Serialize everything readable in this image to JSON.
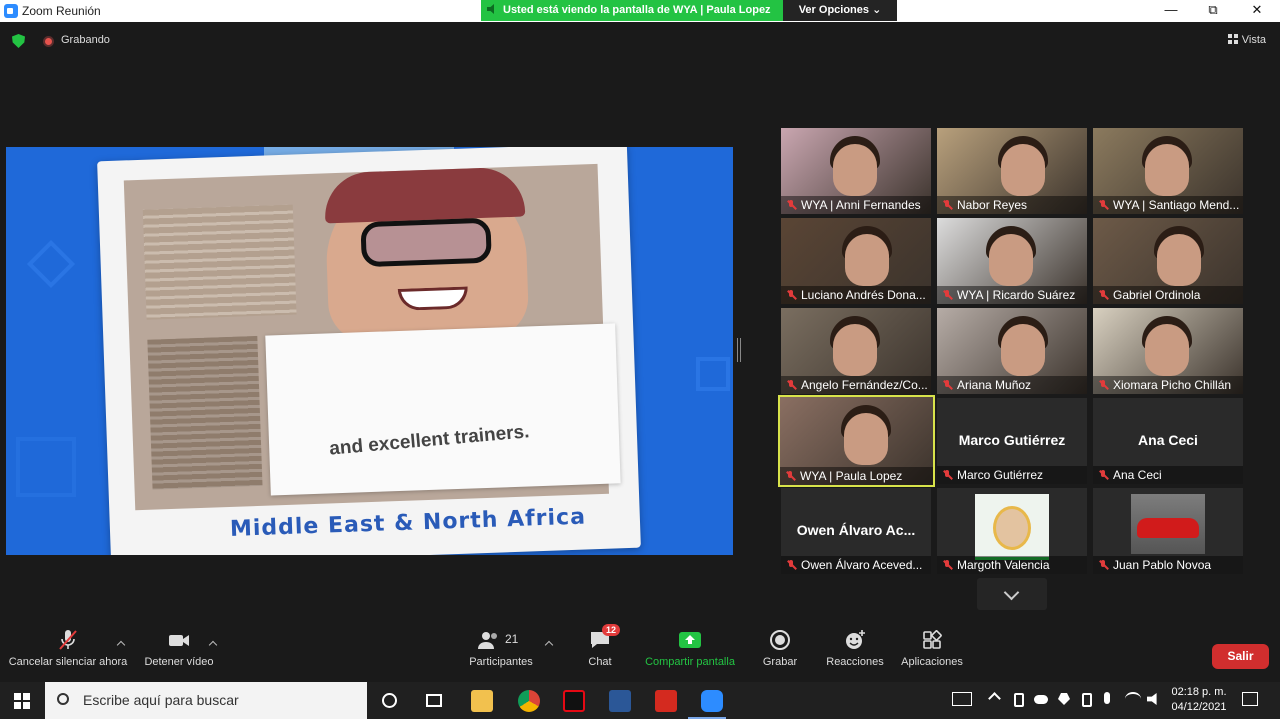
{
  "window": {
    "title": "Zoom Reunión"
  },
  "share_banner": {
    "text": "Usted está viendo la pantalla de WYA | Paula Lopez",
    "options": "Ver Opciones"
  },
  "window_controls": {
    "minimize": "—",
    "restore": "⧉",
    "close": "✕"
  },
  "status": {
    "recording": "Grabando",
    "view": "Vista"
  },
  "shared_screen": {
    "sign_text": "and excellent trainers.",
    "caption": "Middle East & North Africa"
  },
  "participants": [
    {
      "name": "WYA | Anni Fernandes",
      "video": true
    },
    {
      "name": "Nabor Reyes",
      "video": true
    },
    {
      "name": "WYA | Santiago Mend...",
      "video": true
    },
    {
      "name": "Luciano Andrés Dona...",
      "video": true
    },
    {
      "name": "WYA | Ricardo Suárez",
      "video": true
    },
    {
      "name": "Gabriel Ordinola",
      "video": true
    },
    {
      "name": "Angelo Fernández/Co...",
      "video": true
    },
    {
      "name": "Ariana Muñoz",
      "video": true
    },
    {
      "name": "Xiomara Picho Chillán",
      "video": true
    },
    {
      "name": "WYA | Paula Lopez",
      "video": true,
      "active_speaker": true
    },
    {
      "name": "Marco Gutiérrez",
      "big_name": "Marco Gutiérrez",
      "video": false
    },
    {
      "name": "Ana Ceci",
      "big_name": "Ana Ceci",
      "video": false
    },
    {
      "name": "Owen Álvaro Aceved...",
      "big_name": "Owen Álvaro Ac...",
      "video": false
    },
    {
      "name": "Margoth Valencia",
      "video": true
    },
    {
      "name": "Juan Pablo Novoa",
      "video": true
    }
  ],
  "toolbar": {
    "mute": "Cancelar silenciar ahora",
    "video": "Detener vídeo",
    "participants": "Participantes",
    "participants_count": "21",
    "chat": "Chat",
    "chat_badge": "12",
    "share": "Compartir pantalla",
    "record": "Grabar",
    "reactions": "Reacciones",
    "apps": "Aplicaciones",
    "leave": "Salir"
  },
  "taskbar": {
    "search_placeholder": "Escribe aquí para buscar",
    "time": "02:18 p. m.",
    "date": "04/12/2021"
  },
  "colors": {
    "accent_green": "#23c343",
    "leave_red": "#d12e2e",
    "active_border": "#d8e34a",
    "share_bg": "#1f69d9"
  }
}
